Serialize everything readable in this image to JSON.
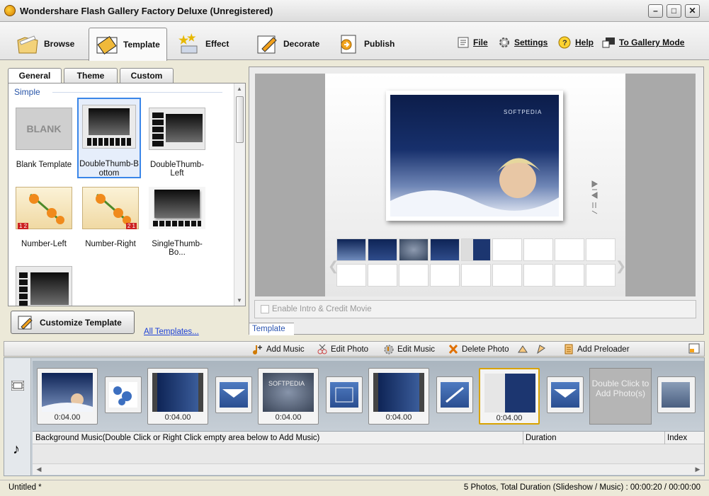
{
  "window": {
    "title": "Wondershare Flash Gallery Factory Deluxe (Unregistered)",
    "controls": [
      "minimize",
      "maximize",
      "close"
    ]
  },
  "toolbar": {
    "tabs": [
      {
        "label": "Browse",
        "icon": "folder-icon"
      },
      {
        "label": "Template",
        "icon": "film-icon",
        "active": true
      },
      {
        "label": "Effect",
        "icon": "stars-icon"
      },
      {
        "label": "Decorate",
        "icon": "pencil-icon"
      },
      {
        "label": "Publish",
        "icon": "publish-icon"
      }
    ],
    "links": [
      {
        "label": "File",
        "icon": "file-icon"
      },
      {
        "label": "Settings",
        "icon": "gear-icon"
      },
      {
        "label": "Help",
        "icon": "help-icon"
      },
      {
        "label": "To Gallery Mode",
        "icon": "gallery-mode-icon"
      }
    ]
  },
  "left_panel": {
    "subtabs": [
      "General",
      "Theme",
      "Custom"
    ],
    "group_label": "Simple",
    "templates": [
      {
        "label": "Blank Template",
        "thumb_text": "BLANK"
      },
      {
        "label": "DoubleThumb-Bottom",
        "selected": true
      },
      {
        "label": "DoubleThumb-Left"
      },
      {
        "label": "Number-Left",
        "badge": "1 2"
      },
      {
        "label": "Number-Right",
        "badge": "2 1"
      },
      {
        "label": "SingleThumb-Bo..."
      }
    ],
    "customize_button": "Customize Template",
    "all_templates_link": "All Templates..."
  },
  "preview": {
    "enable_label": "Enable Intro & Credit Movie",
    "tab_label": "Template",
    "photo_watermark": "SOFTPEDIA"
  },
  "timeline_toolbar": [
    {
      "label": "Add Music",
      "icon": "add-music-icon"
    },
    {
      "label": "Edit Photo",
      "icon": "edit-photo-icon"
    },
    {
      "label": "Edit Music",
      "icon": "edit-music-icon"
    },
    {
      "label": "Delete Photo",
      "icon": "delete-icon"
    },
    {
      "label": "Add Preloader",
      "icon": "preloader-icon"
    }
  ],
  "timeline": {
    "durations": [
      "0:04.00",
      "0:04.00",
      "0:04.00",
      "0:04.00",
      "0:04.00"
    ],
    "add_photo_text": "Double Click to Add Photo(s)",
    "music_columns": [
      "Background Music(Double Click or Right Click empty area below to Add Music)",
      "Duration",
      "Index"
    ]
  },
  "status": {
    "left": "Untitled *",
    "right": "5 Photos, Total Duration (Slideshow / Music) : 00:00:20 / 00:00:00"
  },
  "colors": {
    "accent": "#3a86e8",
    "link": "#1b3fd6",
    "selected_frame": "#d9a300",
    "photo_bg": "#17306c"
  }
}
